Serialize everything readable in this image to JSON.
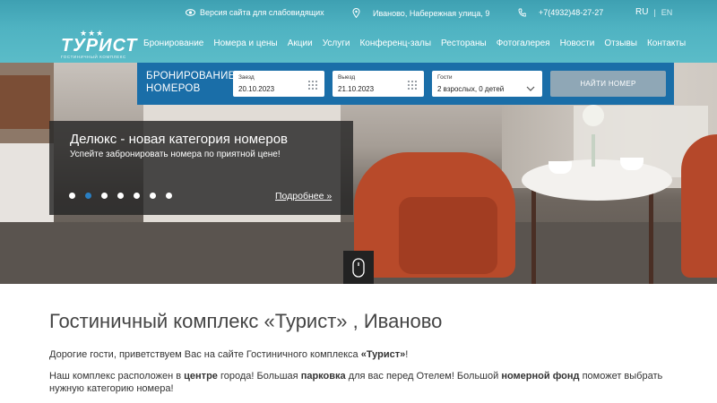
{
  "topbar": {
    "accessibility_link": "Версия сайта для слабовидящих",
    "address": "Иваново, Набережная улица, 9",
    "phone": "+7(4932)48-27-27",
    "lang_ru": "RU",
    "lang_sep": "|",
    "lang_en": "EN"
  },
  "logo": {
    "stars": "★★★",
    "name": "ТУРИСТ",
    "subtitle": "ГОСТИНИЧНЫЙ КОМПЛЕКС"
  },
  "nav": {
    "items": [
      {
        "label": "Бронирование"
      },
      {
        "label": "Номера и цены"
      },
      {
        "label": "Акции"
      },
      {
        "label": "Услуги"
      },
      {
        "label": "Конференц-залы"
      },
      {
        "label": "Рестораны"
      },
      {
        "label": "Фотогалерея"
      },
      {
        "label": "Новости"
      },
      {
        "label": "Отзывы"
      },
      {
        "label": "Контакты"
      }
    ]
  },
  "booking": {
    "title_line1": "БРОНИРОВАНИЕ",
    "title_line2": "НОМЕРОВ",
    "checkin": {
      "label": "Заезд",
      "value": "20.10.2023"
    },
    "checkout": {
      "label": "Выезд",
      "value": "21.10.2023"
    },
    "guests": {
      "label": "Гости",
      "value": "2 взрослых, 0 детей"
    },
    "search_label": "НАЙТИ НОМЕР"
  },
  "slider": {
    "heading": "Делюкс - новая категория номеров",
    "text": "Успейте забронировать номера по приятной цене!",
    "more_link": "Подробнее »",
    "slide_count": 7,
    "active_slide": 2
  },
  "content": {
    "title": "Гостиничный комплекс «Турист» , Иваново",
    "p1_before": "Дорогие гости, приветствуем Вас на сайте Гостиничного комплекса ",
    "p1_bold": "«Турист»",
    "p1_after": "!",
    "p2_a": "Наш комплекс расположен в ",
    "p2_b": "центре",
    "p2_c": " города! Большая ",
    "p2_d": "парковка",
    "p2_e": " для вас перед Отелем! Большой ",
    "p2_f": "номерной фонд",
    "p2_g": " поможет выбрать нужную категорию номера!"
  },
  "colors": {
    "header": "#4fb3c2",
    "booking_bar": "#1a6ea8",
    "search_button": "#8fa7b6",
    "active_dot": "#2a7fc2"
  }
}
